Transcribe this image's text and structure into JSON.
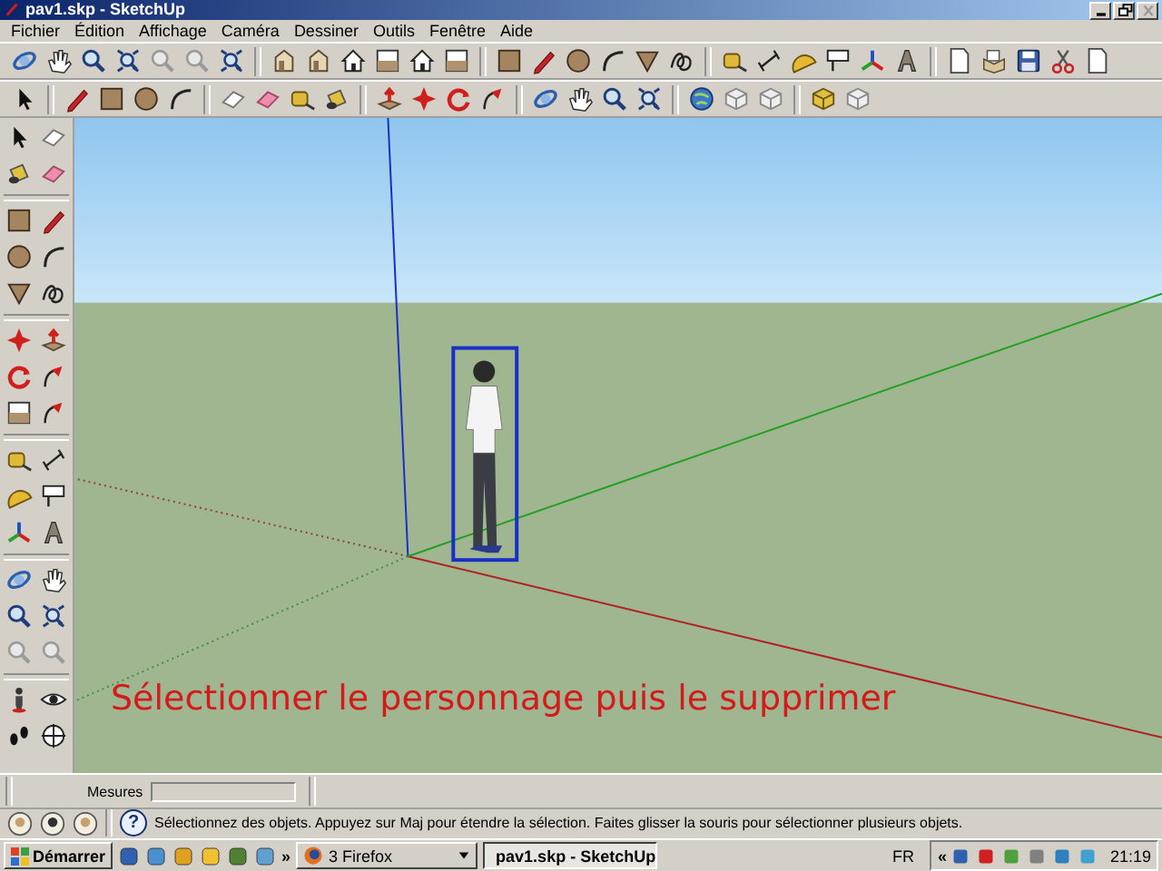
{
  "window": {
    "title": "pav1.skp - SketchUp"
  },
  "menu": [
    "Fichier",
    "Édition",
    "Affichage",
    "Caméra",
    "Dessiner",
    "Outils",
    "Fenêtre",
    "Aide"
  ],
  "canvas": {
    "instruction": "Sélectionner le personnage puis le supprimer",
    "figure": {
      "selected": true
    }
  },
  "status_bar": {
    "measure_label": "Mesures",
    "hint_icon": "?",
    "hint": "Sélectionnez des objets. Appuyez sur Maj pour étendre la sélection. Faites glisser la souris pour sélectionner plusieurs objets."
  },
  "taskbar": {
    "start": "Démarrer",
    "more": "»",
    "buttons": [
      {
        "label": "3 Firefox",
        "selected": false,
        "kind": "group"
      },
      {
        "label": "pav1.skp - SketchUp",
        "selected": true,
        "kind": "window"
      }
    ],
    "language": "FR",
    "tray_expand": "«",
    "clock": "21:19"
  }
}
